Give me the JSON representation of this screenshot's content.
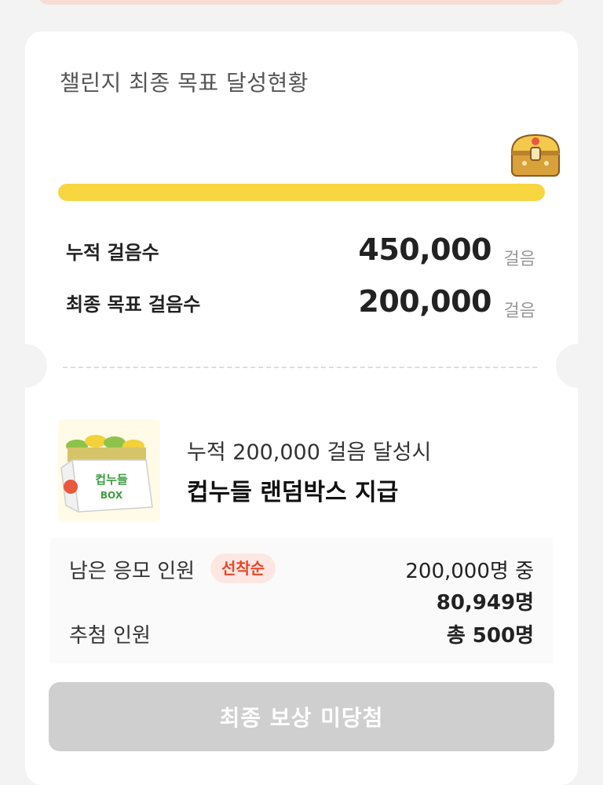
{
  "challenge": {
    "title": "챌린지 최종 목표 달성현황",
    "progress_fraction": 1.0,
    "accent_color": "#f8d640",
    "reward_icon": "treasure-chest-icon"
  },
  "stats": {
    "accumulated_label": "누적 걸음수",
    "accumulated_value": "450,000",
    "goal_label": "최종 목표 걸음수",
    "goal_value": "200,000",
    "unit": "걸음"
  },
  "prize": {
    "image": "cup-noodle-box-image",
    "box_text": "컵누들",
    "box_sub": "BOX",
    "caption": "누적 200,000 걸음 달성시",
    "title": "컵누들 랜덤박스 지급"
  },
  "entries": {
    "remaining_label": "남은 응모 인원",
    "badge": "선착순",
    "remaining_total": "200,000명 중",
    "remaining_count": "80,949명",
    "winners_label": "추첨 인원",
    "winners_value": "총 500명"
  },
  "cta": {
    "label": "최종 보상 미당첨"
  }
}
